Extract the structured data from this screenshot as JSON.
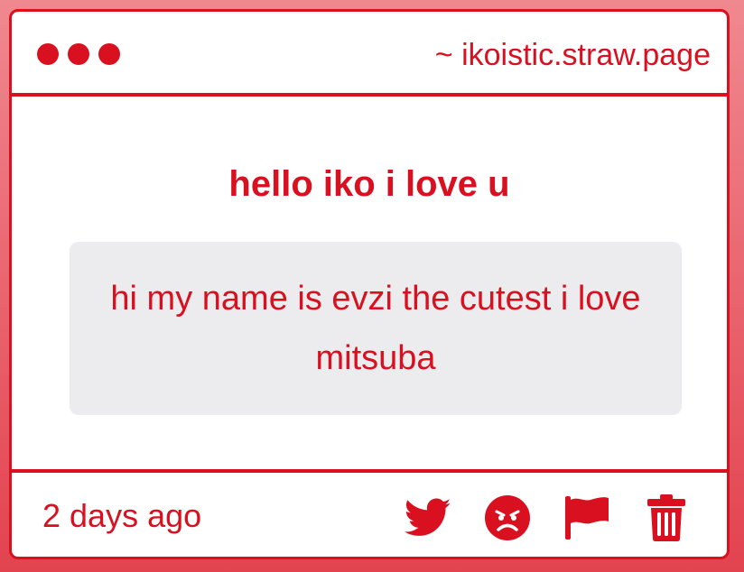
{
  "window": {
    "url": "~ ikoistic.straw.page"
  },
  "post": {
    "title": "hello iko i love u",
    "message": "hi my name is evzi the cutest i love mitsuba",
    "time": "2 days ago"
  },
  "icons": {
    "share": "twitter-icon",
    "react": "angry-face-icon",
    "report": "flag-icon",
    "delete": "trash-icon"
  },
  "colors": {
    "accent": "#d9101f",
    "message_bg": "#ececee",
    "page_bg_top": "#f08890",
    "page_bg_bottom": "#e2434f"
  }
}
